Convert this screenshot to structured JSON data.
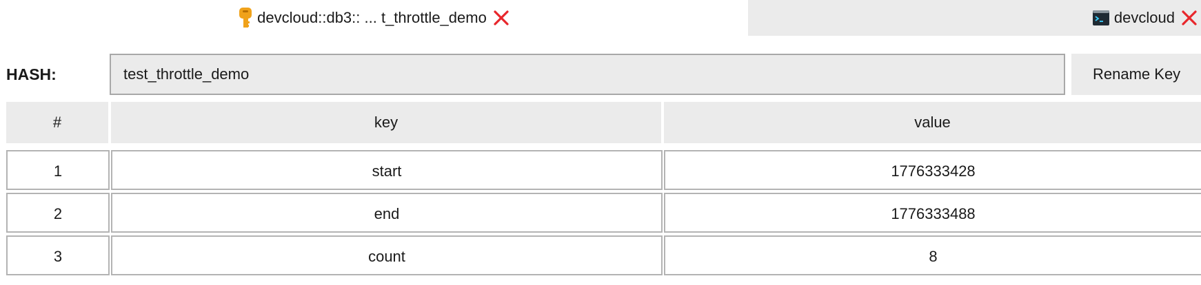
{
  "tabs": [
    {
      "label": "devcloud::db3:: ... t_throttle_demo",
      "icon": "key-icon",
      "active": true
    },
    {
      "label": "devcloud",
      "icon": "terminal-icon",
      "active": false
    }
  ],
  "hash": {
    "label": "HASH:",
    "value": "test_throttle_demo",
    "rename_label": "Rename Key"
  },
  "table": {
    "columns": [
      "#",
      "key",
      "value"
    ],
    "rows": [
      {
        "num": "1",
        "key": "start",
        "value": "1776333428"
      },
      {
        "num": "2",
        "key": "end",
        "value": "1776333488"
      },
      {
        "num": "3",
        "key": "count",
        "value": "8"
      }
    ]
  },
  "colors": {
    "accent_close": "#e8262b",
    "key_icon": "#f0a21a",
    "panel_bg": "#ebebeb"
  }
}
